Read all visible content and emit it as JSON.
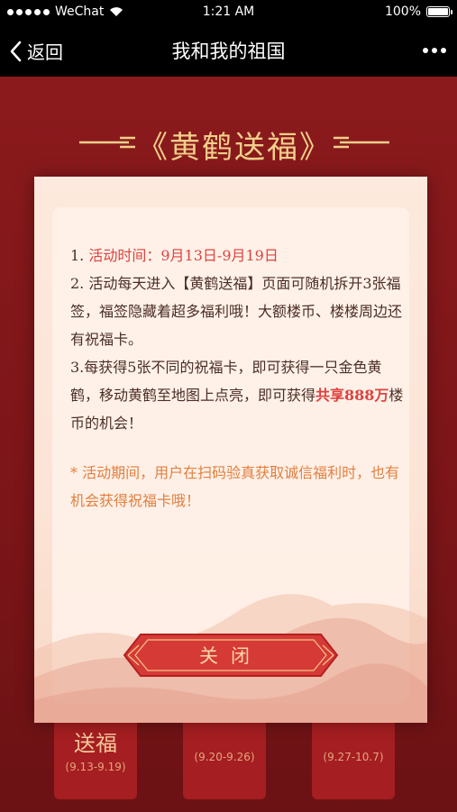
{
  "status_bar": {
    "carrier": "WeChat",
    "time": "1:21 AM",
    "battery": "100%"
  },
  "nav": {
    "back_label": "返回",
    "title": "我和我的祖国"
  },
  "banner": {
    "title": "《黄鹤送福》"
  },
  "background_cards": [
    {
      "title": "送福",
      "dates": "(9.13-9.19)"
    },
    {
      "title": "",
      "dates": "(9.20-9.26)"
    },
    {
      "title": "",
      "dates": "(9.27-10.7)"
    }
  ],
  "modal": {
    "rule1_prefix": "1.",
    "rule1_label": "活动时间：",
    "rule1_dates": "9月13日-9月19日",
    "rule2": "2. 活动每天进入【黄鹤送福】页面可随机拆开3张福签，福签隐藏着超多福利哦！大额楼币、楼楼周边还有祝福卡。",
    "rule3_a": "3.每获得5张不同的祝福卡，即可获得一只金色黄鹤，移动黄鹤至地图上点亮，即可获得",
    "rule3_highlight": "共享888万",
    "rule3_b": "楼币的机会！",
    "note": "* 活动期间，用户在扫码验真获取诚信福利时，也有机会获得祝福卡哦！",
    "close_label": "关闭"
  },
  "colors": {
    "accent_red": "#e0413f",
    "note_orange": "#e08040",
    "gold": "#f2cf8a"
  }
}
